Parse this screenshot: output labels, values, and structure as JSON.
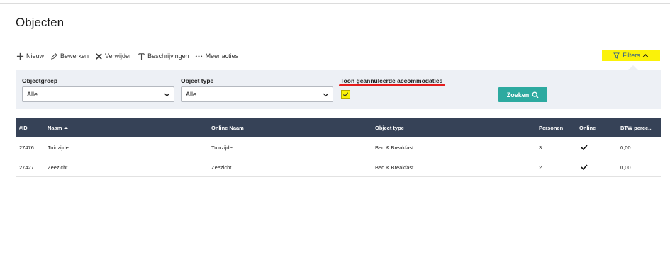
{
  "page": {
    "title": "Objecten"
  },
  "toolbar": {
    "items": [
      {
        "label": "Nieuw",
        "icon": "plus-icon"
      },
      {
        "label": "Bewerken",
        "icon": "pencil-icon"
      },
      {
        "label": "Verwijder",
        "icon": "x-icon"
      },
      {
        "label": "Beschrijvingen",
        "icon": "text-icon"
      },
      {
        "label": "Meer acties",
        "icon": "more-dots-icon"
      }
    ],
    "filters_label": "Filters"
  },
  "filters": {
    "objectgroep": {
      "label": "Objectgroep",
      "value": "Alle"
    },
    "object_type": {
      "label": "Object type",
      "value": "Alle"
    },
    "toon_geannuleerd": {
      "label": "Toon geannuleerde accommodaties",
      "checked": true
    },
    "search_label": "Zoeken"
  },
  "table": {
    "columns": [
      "#ID",
      "Naam",
      "Online Naam",
      "Object type",
      "Personen",
      "Online",
      "BTW perce..."
    ],
    "rows": [
      {
        "id": "27476",
        "naam": "Tuinzijde",
        "online_naam": "Tuinzijde",
        "object_type": "Bed & Breakfast",
        "personen": "3",
        "online": true,
        "btw": "0,00"
      },
      {
        "id": "27427",
        "naam": "Zeezicht",
        "online_naam": "Zeezicht",
        "object_type": "Bed & Breakfast",
        "personen": "2",
        "online": true,
        "btw": "0,00"
      }
    ]
  },
  "colors": {
    "header_bg": "#364257",
    "highlight": "#fbf209",
    "accent": "#2daaa0",
    "annotation": "#e51c1c",
    "panel_bg": "#edf0f5"
  }
}
